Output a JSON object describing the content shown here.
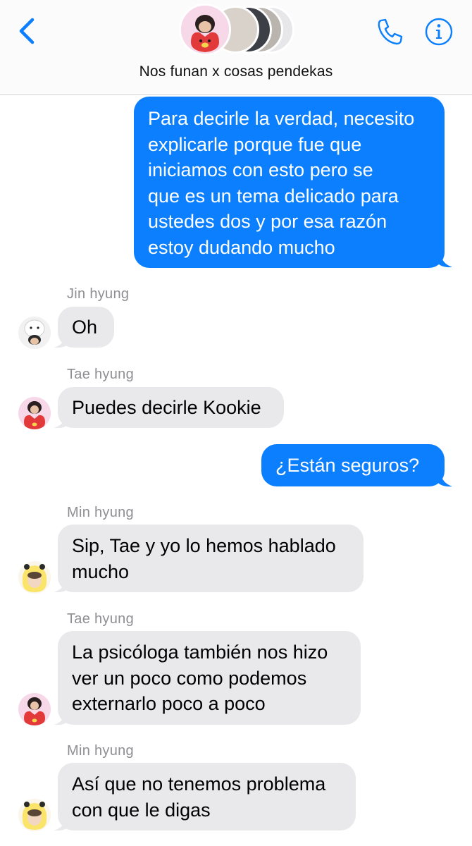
{
  "header": {
    "back_icon": "chevron-left-icon",
    "call_icon": "phone-icon",
    "info_icon": "info-icon",
    "group_name": "Nos funan x cosas pendekas",
    "accent_color": "#0b7ffe"
  },
  "messages": [
    {
      "direction": "outgoing",
      "lines": [
        "Para decirle la verdad, necesito",
        "explicarle porque fue que",
        "iniciamos con esto pero se",
        "que es un tema delicado para",
        "ustedes dos y por esa razón",
        "estoy dudando mucho"
      ]
    },
    {
      "direction": "incoming",
      "sender": "Jin hyung",
      "lines": [
        "Oh"
      ]
    },
    {
      "direction": "incoming",
      "sender": "Tae hyung",
      "lines": [
        "Puedes decirle Kookie"
      ]
    },
    {
      "direction": "outgoing",
      "lines": [
        "¿Están seguros?"
      ]
    },
    {
      "direction": "incoming",
      "sender": "Min hyung",
      "lines": [
        "Sip, Tae y yo lo hemos hablado",
        "mucho"
      ]
    },
    {
      "direction": "incoming",
      "sender": "Tae hyung",
      "lines": [
        "La psicóloga también nos hizo",
        "ver un poco como podemos",
        "externarlo poco a poco"
      ]
    },
    {
      "direction": "incoming",
      "sender": "Min hyung",
      "lines": [
        "Así que no tenemos problema",
        "con que le digas"
      ]
    }
  ],
  "colors": {
    "outgoing_bubble": "#0b7ffe",
    "incoming_bubble": "#e9e9eb",
    "sender_label": "#8e8e93"
  }
}
